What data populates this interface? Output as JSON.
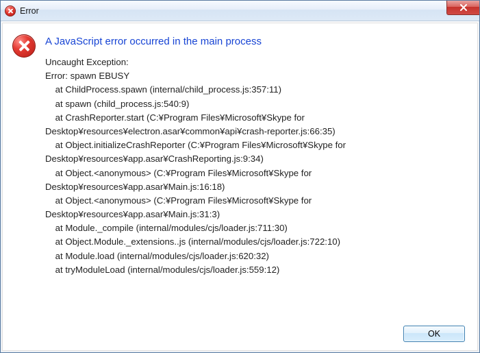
{
  "window": {
    "title": "Error"
  },
  "dialog": {
    "headline": "A JavaScript error occurred in the main process",
    "body": "Uncaught Exception:\nError: spawn EBUSY\n    at ChildProcess.spawn (internal/child_process.js:357:11)\n    at spawn (child_process.js:540:9)\n    at CrashReporter.start (C:¥Program Files¥Microsoft¥Skype for Desktop¥resources¥electron.asar¥common¥api¥crash-reporter.js:66:35)\n    at Object.initializeCrashReporter (C:¥Program Files¥Microsoft¥Skype for Desktop¥resources¥app.asar¥CrashReporting.js:9:34)\n    at Object.<anonymous> (C:¥Program Files¥Microsoft¥Skype for Desktop¥resources¥app.asar¥Main.js:16:18)\n    at Object.<anonymous> (C:¥Program Files¥Microsoft¥Skype for Desktop¥resources¥app.asar¥Main.js:31:3)\n    at Module._compile (internal/modules/cjs/loader.js:711:30)\n    at Object.Module._extensions..js (internal/modules/cjs/loader.js:722:10)\n    at Module.load (internal/modules/cjs/loader.js:620:32)\n    at tryModuleLoad (internal/modules/cjs/loader.js:559:12)"
  },
  "buttons": {
    "ok": "OK"
  },
  "icons": {
    "title_error": "error-icon",
    "body_error": "error-icon",
    "close": "close-icon"
  }
}
